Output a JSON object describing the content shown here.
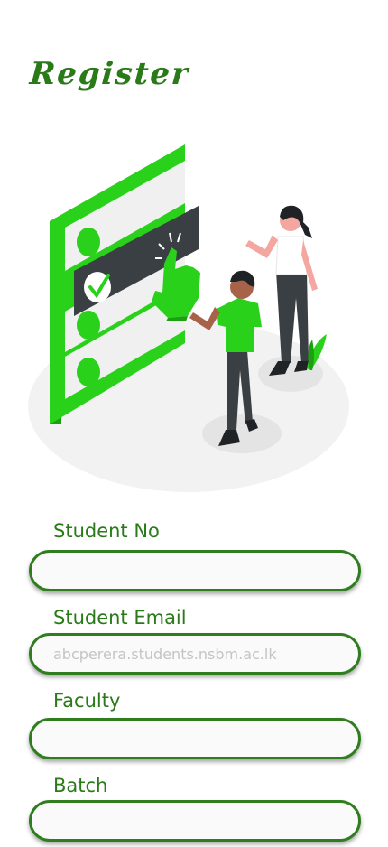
{
  "page": {
    "title": "Register"
  },
  "form": {
    "student_no": {
      "label": "Student No",
      "value": "",
      "placeholder": ""
    },
    "student_email": {
      "label": "Student Email",
      "value": "",
      "placeholder": "abcperera.students.nsbm.ac.lk"
    },
    "faculty": {
      "label": "Faculty",
      "value": "",
      "placeholder": ""
    },
    "batch": {
      "label": "Batch",
      "value": "",
      "placeholder": ""
    }
  },
  "colors": {
    "accent": "#2a7a1a",
    "illustration_green": "#2ad11a",
    "border": "#2f7d1e"
  },
  "icons": {
    "illustration": "registration-illustration",
    "check": "check-icon"
  }
}
